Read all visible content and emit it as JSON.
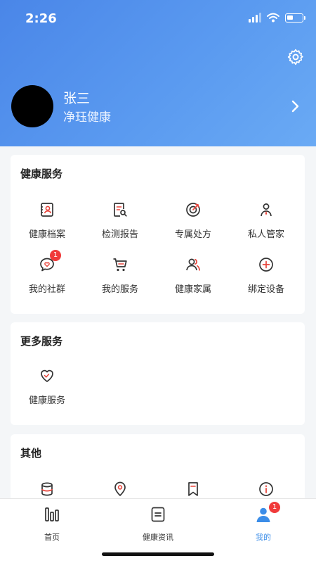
{
  "status_bar": {
    "time": "2:26"
  },
  "profile": {
    "name": "张三",
    "subtitle": "净珏健康"
  },
  "health_services": {
    "title": "健康服务",
    "items": [
      {
        "label": "健康档案",
        "icon": "health-record-icon"
      },
      {
        "label": "检测报告",
        "icon": "report-search-icon"
      },
      {
        "label": "专属处方",
        "icon": "target-icon"
      },
      {
        "label": "私人管家",
        "icon": "butler-icon"
      },
      {
        "label": "我的社群",
        "icon": "community-icon",
        "badge": "1"
      },
      {
        "label": "我的服务",
        "icon": "cart-icon"
      },
      {
        "label": "健康家属",
        "icon": "family-icon"
      },
      {
        "label": "绑定设备",
        "icon": "plus-circle-icon"
      }
    ]
  },
  "more_services": {
    "title": "更多服务",
    "items": [
      {
        "label": "健康服务",
        "icon": "heart-icon"
      }
    ]
  },
  "other": {
    "title": "其他",
    "items": [
      {
        "icon": "database-icon"
      },
      {
        "icon": "location-pin-icon"
      },
      {
        "icon": "bookmark-icon"
      },
      {
        "icon": "info-icon"
      }
    ]
  },
  "tabbar": {
    "items": [
      {
        "label": "首页",
        "icon": "bar-chart-icon",
        "active": false
      },
      {
        "label": "健康资讯",
        "icon": "news-icon",
        "active": false
      },
      {
        "label": "我的",
        "icon": "user-icon",
        "active": true,
        "badge": "1"
      }
    ]
  },
  "colors": {
    "header_gradient_start": "#4a86e8",
    "header_gradient_end": "#6aaaf4",
    "accent": "#3b8de8",
    "badge": "#f03a3a",
    "icon_accent": "#e8453c"
  }
}
